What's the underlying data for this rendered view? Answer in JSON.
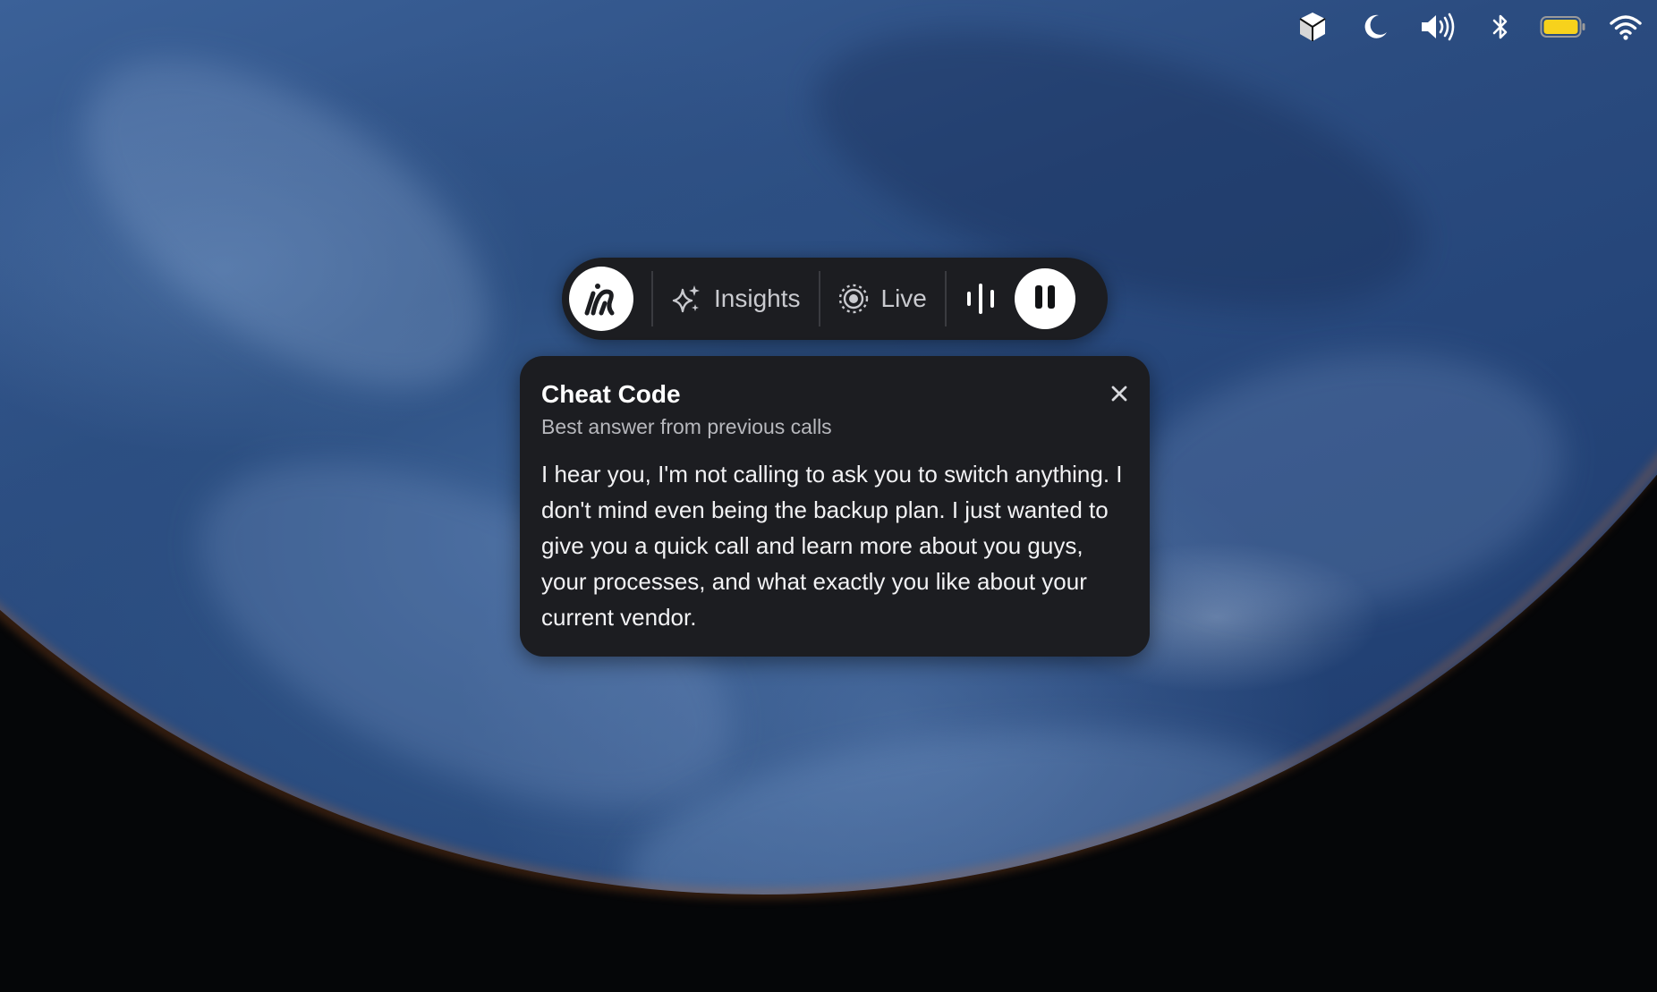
{
  "menubar": {
    "icons": [
      "cube-icon",
      "moon-icon",
      "speaker-icon",
      "bluetooth-icon",
      "battery-icon",
      "wifi-icon"
    ],
    "battery_color": "#f7d21c"
  },
  "toolbar": {
    "logo_icon": "app-logo-icon",
    "insights_label": "Insights",
    "live_label": "Live",
    "wave_icon": "audio-wave-icon",
    "pause_icon": "pause-icon"
  },
  "card": {
    "title": "Cheat Code",
    "subtitle": "Best answer from previous calls",
    "body": "I hear you, I'm not calling to ask you to switch anything. I don't mind even being the backup plan. I just wanted to give you a quick call and learn more about you guys, your processes, and what exactly you like about your current vendor.",
    "close_icon": "close-icon"
  },
  "colors": {
    "panel_bg": "#1c1d21",
    "accent_white": "#ffffff",
    "muted_text": "#c9cacf"
  }
}
